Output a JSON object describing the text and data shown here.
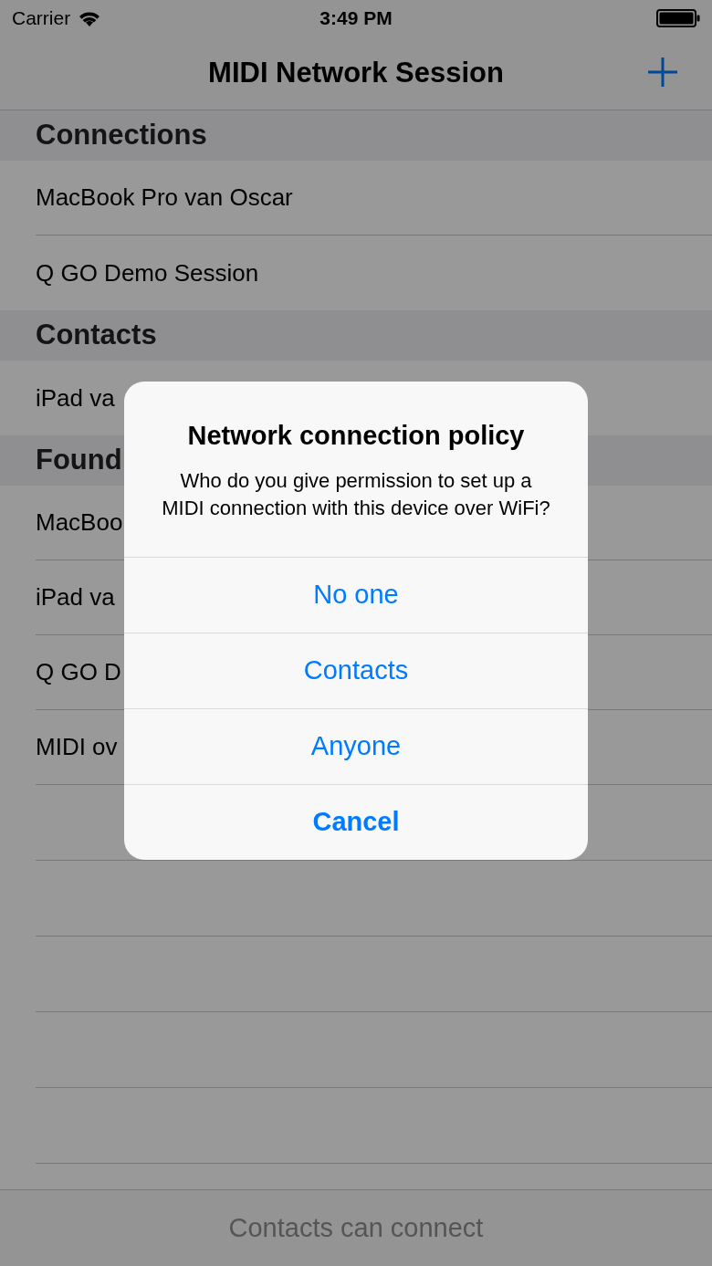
{
  "status_bar": {
    "carrier": "Carrier",
    "time": "3:49 PM"
  },
  "nav": {
    "title": "MIDI Network Session"
  },
  "sections": [
    {
      "title": "Connections",
      "rows": [
        "MacBook Pro van Oscar",
        "Q GO Demo Session"
      ]
    },
    {
      "title": "Contacts",
      "rows": [
        "iPad va"
      ]
    },
    {
      "title": "Found",
      "rows": [
        "MacBoo",
        "iPad va",
        "Q GO D",
        "MIDI ov"
      ]
    }
  ],
  "toolbar": {
    "text": "Contacts can connect"
  },
  "alert": {
    "title": "Network connection policy",
    "message": "Who do you give permission to set up a MIDI connection with this device over WiFi?",
    "actions": [
      {
        "label": "No one",
        "kind": "default"
      },
      {
        "label": "Contacts",
        "kind": "default"
      },
      {
        "label": "Anyone",
        "kind": "default"
      },
      {
        "label": "Cancel",
        "kind": "cancel"
      }
    ]
  }
}
